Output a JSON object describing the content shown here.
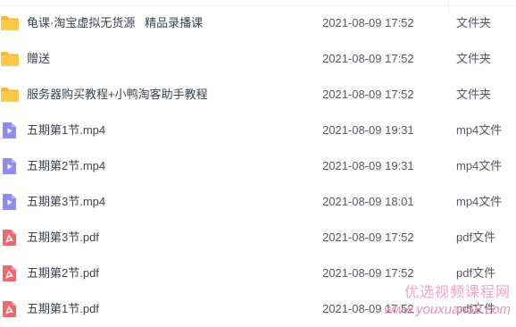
{
  "files": [
    {
      "name": "龟课·淘宝虚拟无货源   精品录播课",
      "date": "2021-08-09 17:52",
      "type": "文件夹",
      "icon": "folder-icon"
    },
    {
      "name": "赠送",
      "date": "2021-08-09 17:52",
      "type": "文件夹",
      "icon": "folder-icon"
    },
    {
      "name": "服务器购买教程+小鸭淘客助手教程",
      "date": "2021-08-09 17:52",
      "type": "文件夹",
      "icon": "folder-icon"
    },
    {
      "name": "五期第1节.mp4",
      "date": "2021-08-09 19:31",
      "type": "mp4文件",
      "icon": "video-file-icon"
    },
    {
      "name": "五期第2节.mp4",
      "date": "2021-08-09 19:31",
      "type": "mp4文件",
      "icon": "video-file-icon"
    },
    {
      "name": "五期第3节.mp4",
      "date": "2021-08-09 18:01",
      "type": "mp4文件",
      "icon": "video-file-icon"
    },
    {
      "name": "五期第3节.pdf",
      "date": "2021-08-09 17:52",
      "type": "pdf文件",
      "icon": "pdf-file-icon"
    },
    {
      "name": "五期第2节.pdf",
      "date": "2021-08-09 17:52",
      "type": "pdf文件",
      "icon": "pdf-file-icon"
    },
    {
      "name": "五期第1节.pdf",
      "date": "2021-08-09 17:52",
      "type": "pdf文件",
      "icon": "pdf-file-icon"
    }
  ],
  "watermark": {
    "line1": "优选视频课程网",
    "line2": "www.youxuan68.com"
  },
  "colors": {
    "folder": "#ffc94a",
    "video": "#8f8cf0",
    "pdf": "#f2676c",
    "text": "#3c4250",
    "muted": "#525866"
  }
}
